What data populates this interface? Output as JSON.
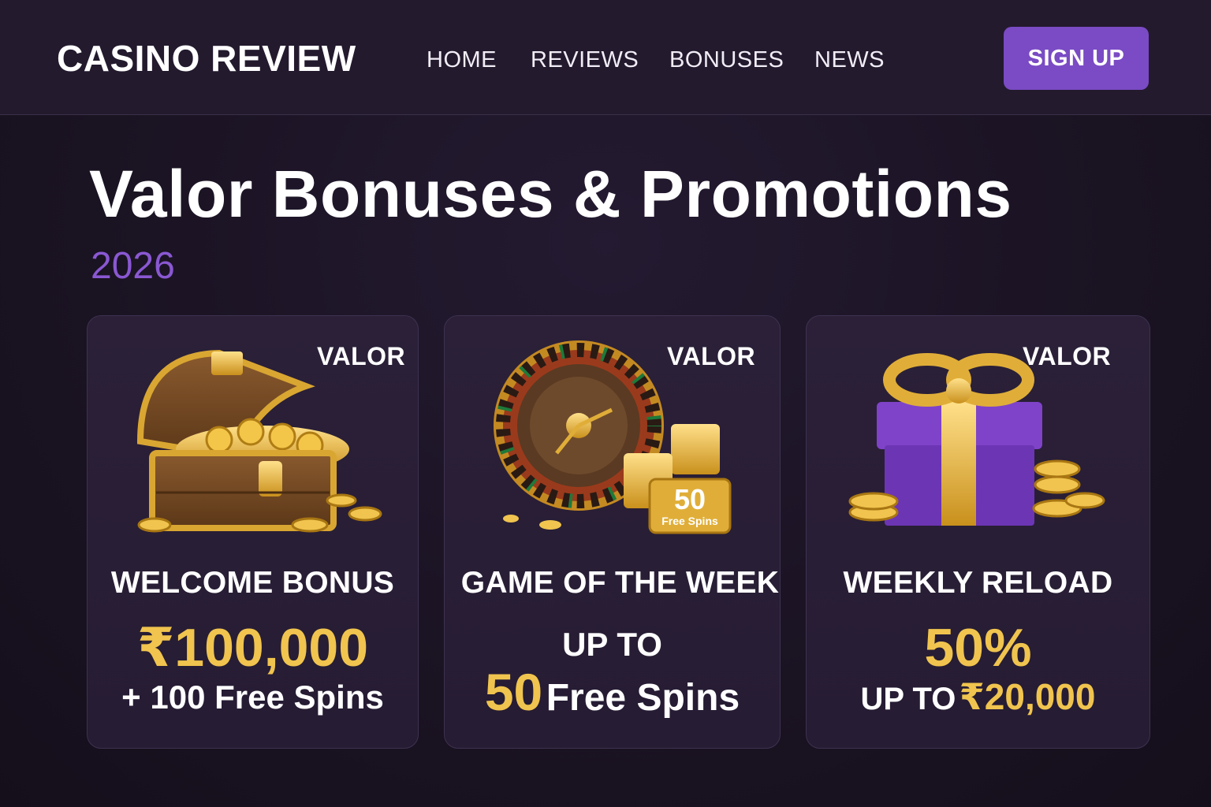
{
  "header": {
    "logo": "CASINO REVIEW",
    "nav": [
      "HOME",
      "REVIEWS",
      "BONUSES",
      "NEWS"
    ],
    "signup_label": "SIGN UP"
  },
  "page": {
    "title": "Valor Bonuses & Promotions",
    "year": "2026"
  },
  "cards": [
    {
      "brand": "VALOR",
      "title": "WELCOME BONUS",
      "amount": "₹100,000",
      "extra": "+ 100 Free Spins",
      "icon": "treasure-chest-icon"
    },
    {
      "brand": "VALOR",
      "title": "GAME OF THE WEEK",
      "prefix": "UP TO",
      "amount": "50",
      "extra": "Free Spins",
      "badge_number": "50",
      "badge_label": "Free Spins",
      "icon": "roulette-wheel-icon"
    },
    {
      "brand": "VALOR",
      "title": "WEEKLY RELOAD",
      "amount": "50%",
      "prefix": "UP TO",
      "extra": "₹20,000",
      "icon": "gift-box-icon"
    }
  ],
  "colors": {
    "background": "#1a1322",
    "header": "#231a2e",
    "accent": "#7a4bc4",
    "year": "#8a58d2",
    "gold": "#f0c44e"
  }
}
